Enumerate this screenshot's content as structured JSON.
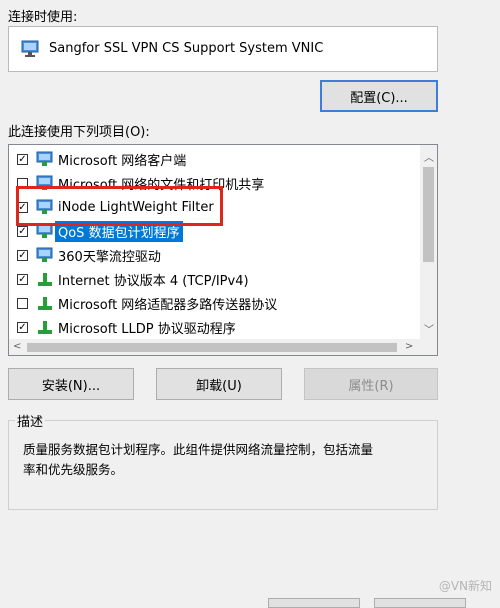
{
  "connect_using_label": "连接时使用:",
  "adapter": {
    "name": "Sangfor SSL VPN CS Support System VNIC",
    "icon": "network-adapter-icon"
  },
  "configure_button": "配置(C)...",
  "items_label": "此连接使用下列项目(O):",
  "items": [
    {
      "label": "Microsoft 网络客户端",
      "checked": true,
      "icon": "network-client-icon",
      "selected": false
    },
    {
      "label": "Microsoft 网络的文件和打印机共享",
      "checked": false,
      "icon": "network-client-icon",
      "selected": false
    },
    {
      "label": "iNode LightWeight Filter",
      "checked": true,
      "icon": "network-client-icon",
      "selected": false
    },
    {
      "label": "QoS 数据包计划程序",
      "checked": true,
      "icon": "network-client-icon",
      "selected": true
    },
    {
      "label": "360天擎流控驱动",
      "checked": true,
      "icon": "network-client-icon",
      "selected": false
    },
    {
      "label": "Internet 协议版本 4 (TCP/IPv4)",
      "checked": true,
      "icon": "protocol-icon",
      "selected": false
    },
    {
      "label": "Microsoft 网络适配器多路传送器协议",
      "checked": false,
      "icon": "protocol-icon",
      "selected": false
    },
    {
      "label": "Microsoft LLDP 协议驱动程序",
      "checked": true,
      "icon": "protocol-icon",
      "selected": false
    }
  ],
  "install_button": "安装(N)...",
  "uninstall_button": "卸载(U)",
  "properties_button": "属性(R)",
  "description_label": "描述",
  "description_text_line1": "质量服务数据包计划程序。此组件提供网络流量控制，包括流量",
  "description_text_line2": "率和优先级服务。",
  "watermark": "@VN新知",
  "colors": {
    "selection": "#0078d7",
    "highlight_box": "#e0261b",
    "protocol_icon": "#2a9d3b"
  }
}
